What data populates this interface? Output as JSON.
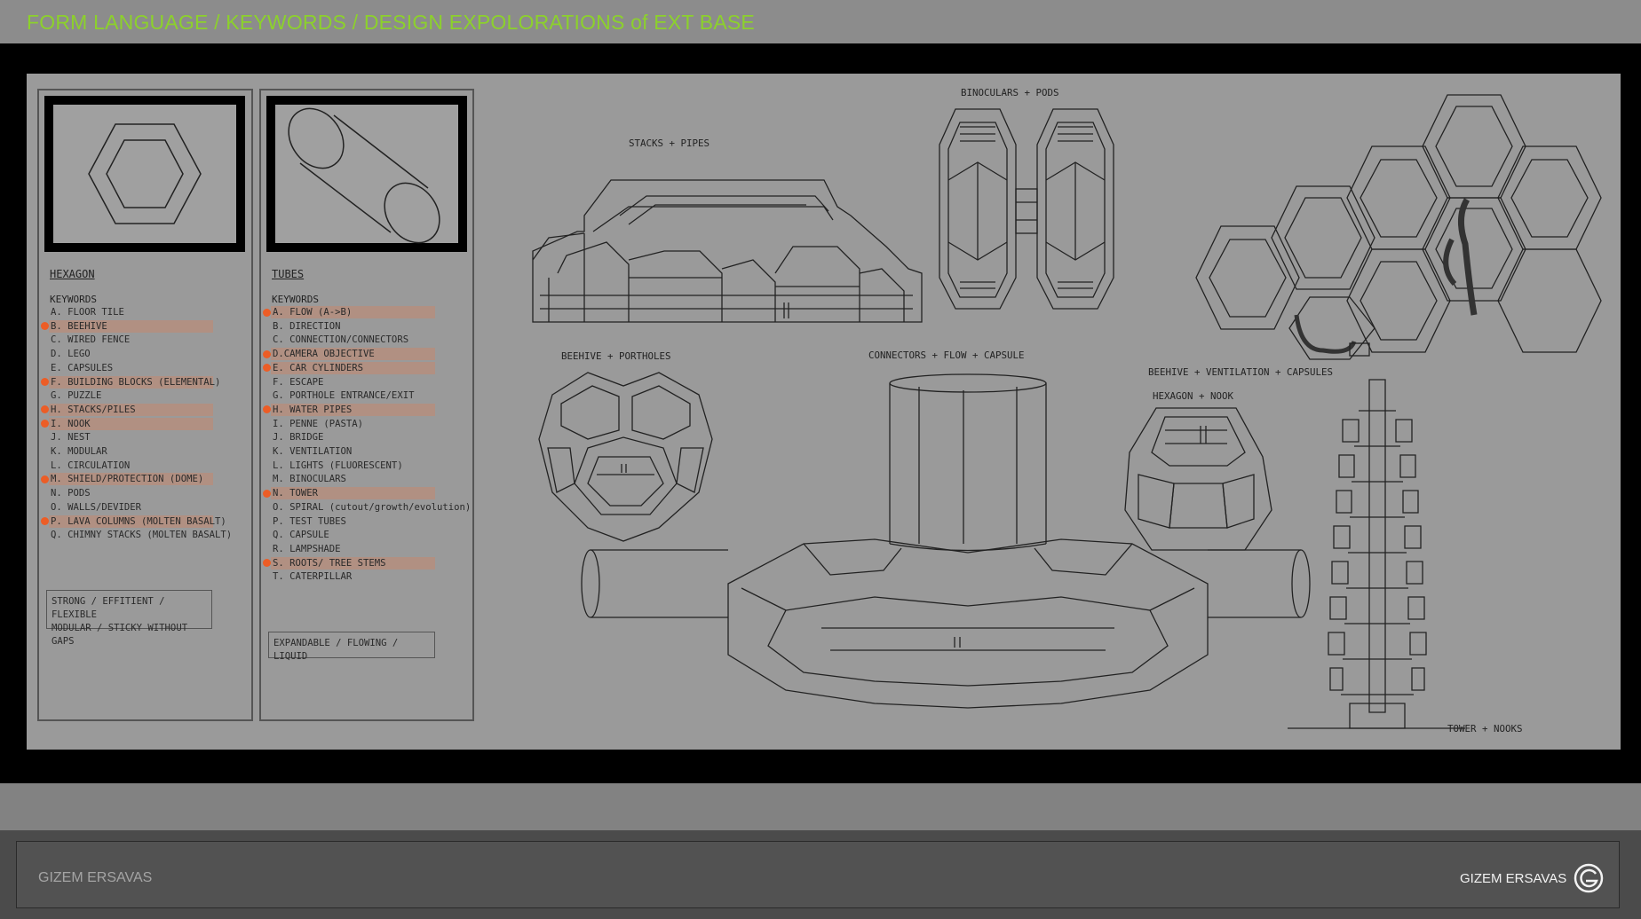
{
  "title": "FORM LANGUAGE / KEYWORDS / DESIGN EXPOLORATIONS of EXT BASE",
  "author": "GIZEM ERSAVAS",
  "colors": {
    "title": "#8cd12c",
    "highlight_dot": "#ec5d26",
    "board": "#9a9a9a",
    "footer": "#4b4b4b"
  },
  "hexagon_panel": {
    "title": "HEXAGON",
    "keywords_heading": "KEYWORDS",
    "keywords": [
      {
        "text": "A. FLOOR TILE",
        "highlighted": false
      },
      {
        "text": "B. BEEHIVE",
        "highlighted": true
      },
      {
        "text": "C. WIRED FENCE",
        "highlighted": false
      },
      {
        "text": "D. LEGO",
        "highlighted": false
      },
      {
        "text": "E. CAPSULES",
        "highlighted": false
      },
      {
        "text": "F. BUILDING BLOCKS (ELEMENTAL)",
        "highlighted": true
      },
      {
        "text": "G. PUZZLE",
        "highlighted": false
      },
      {
        "text": "H. STACKS/PILES",
        "highlighted": true
      },
      {
        "text": "I. NOOK",
        "highlighted": true
      },
      {
        "text": "J. NEST",
        "highlighted": false
      },
      {
        "text": "K. MODULAR",
        "highlighted": false
      },
      {
        "text": "L. CIRCULATION",
        "highlighted": false
      },
      {
        "text": "M. SHIELD/PROTECTION (DOME)",
        "highlighted": true
      },
      {
        "text": "N. PODS",
        "highlighted": false
      },
      {
        "text": "O. WALLS/DEVIDER",
        "highlighted": false
      },
      {
        "text": "P. LAVA COLUMNS (MOLTEN BASALT)",
        "highlighted": true
      },
      {
        "text": "Q. CHIMNY STACKS (MOLTEN BASALT)",
        "highlighted": false
      }
    ],
    "summary": [
      "STRONG / EFFITIENT / FLEXIBLE",
      "MODULAR / STICKY WITHOUT GAPS"
    ]
  },
  "tubes_panel": {
    "title": "TUBES",
    "keywords_heading": "KEYWORDS",
    "keywords": [
      {
        "text": "A. FLOW (A->B)",
        "highlighted": true
      },
      {
        "text": "B. DIRECTION",
        "highlighted": false
      },
      {
        "text": "C. CONNECTION/CONNECTORS",
        "highlighted": false
      },
      {
        "text": "D.CAMERA OBJECTIVE",
        "highlighted": true
      },
      {
        "text": "E. CAR CYLINDERS",
        "highlighted": true
      },
      {
        "text": "F. ESCAPE",
        "highlighted": false
      },
      {
        "text": "G. PORTHOLE ENTRANCE/EXIT",
        "highlighted": false
      },
      {
        "text": "H. WATER PIPES",
        "highlighted": true
      },
      {
        "text": "I. PENNE (PASTA)",
        "highlighted": false
      },
      {
        "text": "J. BRIDGE",
        "highlighted": false
      },
      {
        "text": "K. VENTILATION",
        "highlighted": false
      },
      {
        "text": "L. LIGHTS (FLUORESCENT)",
        "highlighted": false
      },
      {
        "text": "M. BINOCULARS",
        "highlighted": false
      },
      {
        "text": "N. TOWER",
        "highlighted": true
      },
      {
        "text": "O. SPIRAL (cutout/growth/evolution)",
        "highlighted": false
      },
      {
        "text": "P. TEST TUBES",
        "highlighted": false
      },
      {
        "text": "Q. CAPSULE",
        "highlighted": false
      },
      {
        "text": "R. LAMPSHADE",
        "highlighted": false
      },
      {
        "text": "S. ROOTS/ TREE STEMS",
        "highlighted": true
      },
      {
        "text": "T. CATERPILLAR",
        "highlighted": false
      }
    ],
    "summary": [
      "EXPANDABLE / FLOWING / LIQUID"
    ]
  },
  "sketch_labels": {
    "stacks": "STACKS + PIPES",
    "binoculars": "BINOCULARS + PODS",
    "beehive_portholes": "BEEHIVE + PORTHOLES",
    "connectors": "CONNECTORS + FLOW + CAPSULE",
    "beehive_vent": "BEEHIVE + VENTILATION + CAPSULES",
    "hex_nook": "HEXAGON + NOOK",
    "tower": "TOWER + NOOKS"
  }
}
